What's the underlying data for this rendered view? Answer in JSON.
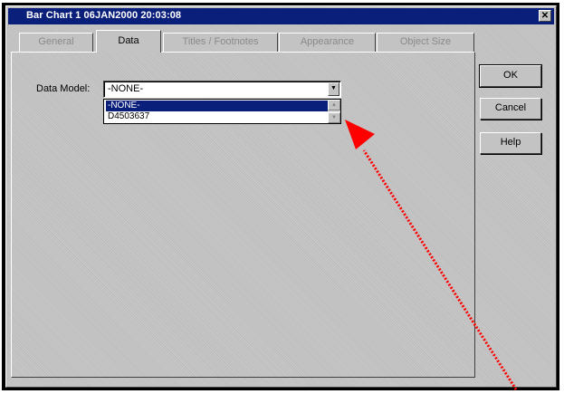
{
  "window": {
    "title": "Bar Chart 1 06JAN2000 20:03:08",
    "close_glyph": "✕"
  },
  "tabs": [
    {
      "label": "General",
      "active": false
    },
    {
      "label": "Data",
      "active": true
    },
    {
      "label": "Titles / Footnotes",
      "active": false
    },
    {
      "label": "Appearance",
      "active": false
    },
    {
      "label": "Object Size",
      "active": false
    }
  ],
  "data_model": {
    "label": "Data Model:",
    "value": "-NONE-",
    "options": [
      "-NONE-",
      "D4503637"
    ],
    "highlighted_option": "-NONE-"
  },
  "buttons": {
    "ok": "OK",
    "cancel": "Cancel",
    "help": "Help"
  },
  "annotation": {
    "arrow_color": "#ff0000"
  },
  "icons": [
    "close-icon",
    "chevron-down-icon",
    "scroll-up-icon",
    "scroll-down-icon"
  ]
}
